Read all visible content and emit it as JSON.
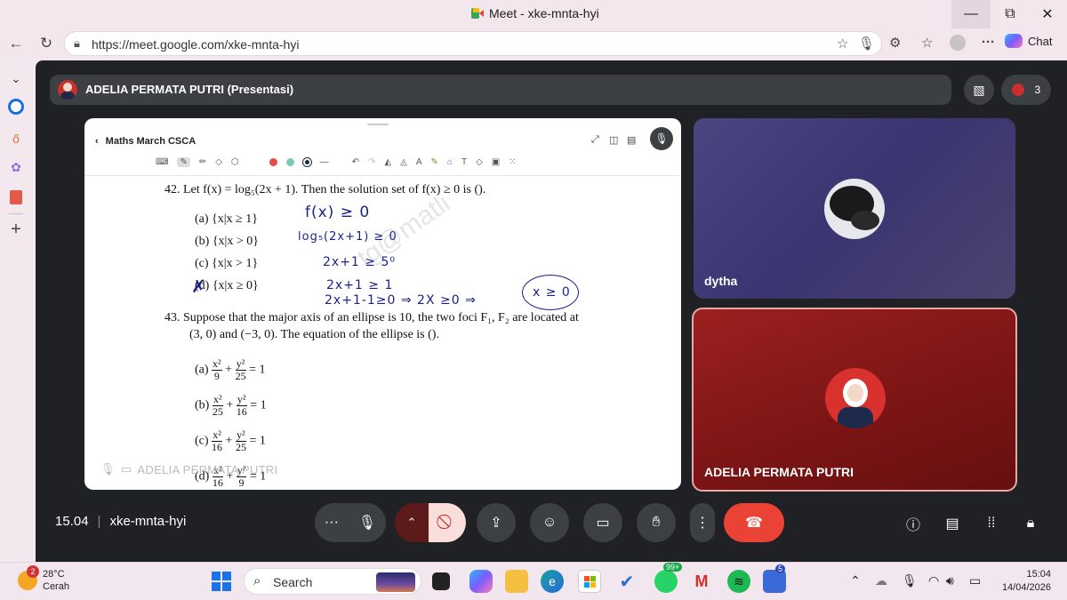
{
  "window": {
    "title": "Meet - xke-mnta-hyi",
    "minimize": "—",
    "maximize": "⧉",
    "close": "✕"
  },
  "browser": {
    "url": "https://meet.google.com/xke-mnta-hyi",
    "chat_label": "Chat",
    "more": "···"
  },
  "meet": {
    "presenter_bar_title": "ADELIA PERMATA PUTRI (Presentasi)",
    "participant_count": "3",
    "time": "15.04",
    "meeting_code": "xke-mnta-hyi",
    "participants": [
      {
        "name": "dytha"
      },
      {
        "name": "ADELIA PERMATA PUTRI"
      }
    ],
    "presenter_tag": "ADELIA PERMATA PUTRI",
    "accent_red": "#ea4335"
  },
  "presentation": {
    "doc_title": "Maths March CSCA",
    "watermark": "tg@matli",
    "q42": {
      "stem": "42. Let f(x) = log₅(2x + 1). Then the solution set of f(x) ≥ 0 is ().",
      "options": [
        "(a) {x|x ≥ 1}",
        "(b) {x|x > 0}",
        "(c) {x|x > 1}",
        "{x|x ≥ 0}"
      ],
      "option_d_mark": "(d)"
    },
    "handwriting": [
      "f(x) ≥ 0",
      "log₅(2x+1) ≥ 0",
      "2x+1  ≥ 5⁰",
      "2x+1 ≥ 1",
      "2x+1-1≥0 ⇒ 2X ≥0 ⇒",
      "x ≥ 0"
    ],
    "q43": {
      "stem1": "43. Suppose that the major axis of an ellipse is 10, the two foci F₁, F₂ are located at",
      "stem2": "(3, 0) and (−3, 0). The equation of the ellipse is ().",
      "options": [
        {
          "label": "(a)",
          "a": "x²",
          "b": "9",
          "c": "y²",
          "d": "25"
        },
        {
          "label": "(b)",
          "a": "x²",
          "b": "25",
          "c": "y²",
          "d": "16"
        },
        {
          "label": "(c)",
          "a": "x²",
          "b": "16",
          "c": "y²",
          "d": "25"
        },
        {
          "label": "(d)",
          "a": "x²",
          "b": "16",
          "c": "y²",
          "d": "9"
        }
      ],
      "equals": "= 1",
      "plus": "+"
    }
  },
  "taskbar": {
    "temperature": "28°C",
    "weather": "Cerah",
    "weather_badge": "2",
    "search_placeholder": "Search",
    "whatsapp_badge": "99+",
    "app_badge": "5",
    "time": "15:04",
    "date": "14/04/2026"
  }
}
